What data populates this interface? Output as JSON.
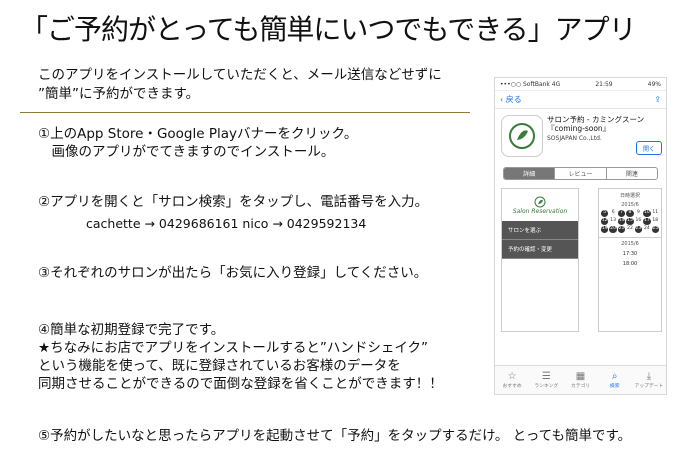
{
  "title": "「ご予約がとっても簡単にいつでもできる」アプリ",
  "intro": {
    "line1": "このアプリをインストールしていただくと、メール送信などせずに",
    "line2": "”簡単”に予約ができます。"
  },
  "steps": {
    "s1_line1": "①上のApp Store・Google Playバナーをクリック。",
    "s1_line2": "　画像のアプリがでてきますのでインストール。",
    "s2_line1": "②アプリを開くと「サロン検索」をタップし、電話番号を入力。",
    "s2_sub": "cachette → 0429686161 nico → 0429592134",
    "s3": "③それぞれのサロンが出たら「お気に入り登録」してください。",
    "s4_line1": "④簡単な初期登録で完了です。",
    "s4_line2": "★ちなみにお店でアプリをインストールすると”ハンドシェイク”",
    "s4_line3": "という機能を使って、既に登録されているお客様のデータを",
    "s4_line4": "同期させることができるので面倒な登録を省くことができます！！",
    "s5": "⑤予約がしたいなと思ったらアプリを起動させて「予約」をタップするだけ。 とっても簡単です。"
  },
  "phone": {
    "status_left": "•••○○ SoftBank 4G",
    "status_time": "21:59",
    "status_right": "49%",
    "back_label": "戻る",
    "app_name": "サロン予約 - カミングスーン 『coming-soon』",
    "developer": "SOSJAPAN Co.,Ltd.",
    "get_label": "開く",
    "segments": [
      "詳細",
      "レビュー",
      "関連"
    ],
    "shot1": {
      "brand": "Salon Reservation",
      "menu1": "サロンを選ぶ",
      "menu2": "予約の確認・変更"
    },
    "shot2": {
      "header": "日時選択",
      "month1": "2015/6",
      "month2": "2015/6",
      "days": [
        "5",
        "6",
        "7",
        "8",
        "9",
        "10",
        "11",
        "12",
        "13",
        "14",
        "15",
        "16",
        "17",
        "18",
        "19",
        "20",
        "21",
        "22",
        "23",
        "24",
        "25"
      ],
      "times": [
        "17:30",
        "18:00"
      ]
    },
    "tabs": [
      "おすすめ",
      "ランキング",
      "カテゴリ",
      "検索",
      "アップデート"
    ],
    "tab_icons": [
      "star-icon",
      "list-icon",
      "grid-icon",
      "search-icon",
      "download-icon"
    ],
    "accent": "#1a73e8",
    "brand_green": "#3a7a3a"
  }
}
